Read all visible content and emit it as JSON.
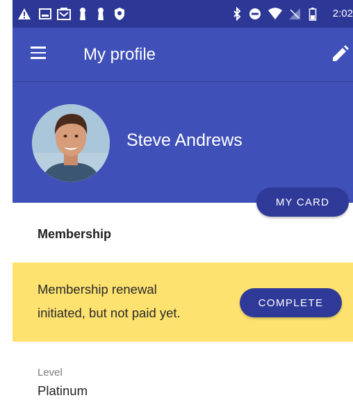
{
  "status_bar": {
    "time": "2:02",
    "icons": [
      "warning-icon",
      "image-icon",
      "gallery-icon",
      "keyhole-icon",
      "keyhole-icon",
      "shield-icon",
      "bluetooth-icon",
      "do-not-disturb-icon",
      "wifi-icon",
      "signal-icon",
      "battery-icon"
    ]
  },
  "app_bar": {
    "title": "My profile",
    "menu_icon": "menu-icon",
    "edit_icon": "pencil-icon"
  },
  "profile": {
    "name": "Steve Andrews",
    "my_card_label": "MY CARD"
  },
  "membership": {
    "section_title": "Membership",
    "banner_line_1": "Membership renewal",
    "banner_line_2": "initiated, but not paid yet.",
    "complete_label": "COMPLETE",
    "banner_color": "#fde26f"
  },
  "fields": {
    "level_label": "Level",
    "level_value": "Platinum"
  },
  "colors": {
    "primary": "#3f50b8",
    "primary_dark": "#2c3796",
    "button": "#2f3a98"
  }
}
